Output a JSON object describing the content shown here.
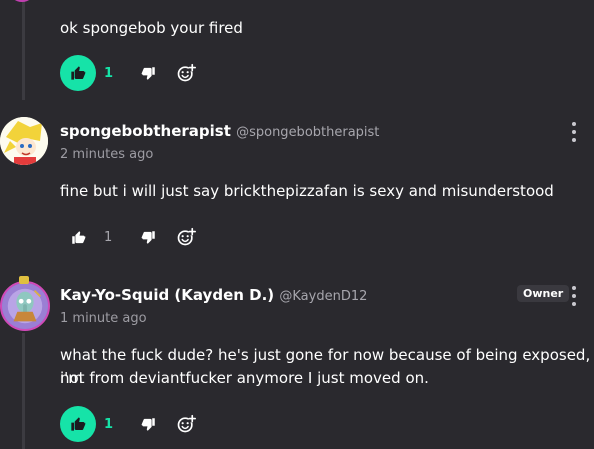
{
  "comments": [
    {
      "text": "ok spongebob your fired",
      "likes": "1",
      "liked": true
    },
    {
      "author": "spongebobtherapist",
      "handle": "@spongebobtherapist",
      "time": "2 minutes ago",
      "text": "fine but i will just say brickthepizzafan is sexy and misunderstood",
      "likes": "1",
      "liked": false
    },
    {
      "author": "Kay-Yo-Squid (Kayden D.)",
      "handle": "@KaydenD12",
      "time": "1 minute ago",
      "badge": "Owner",
      "text_line1": "what the fuck dude? he's just gone for now because of being exposed, i'm",
      "text_line2": "not from deviantfucker anymore I just moved on.",
      "likes": "1",
      "liked": true
    }
  ],
  "colors": {
    "background": "#2a292e",
    "accent": "#16e3a8",
    "muted": "#a7a6ad"
  },
  "icons": [
    "thumbs-up-icon",
    "thumbs-down-icon",
    "add-reaction-icon",
    "more-vert-icon"
  ]
}
